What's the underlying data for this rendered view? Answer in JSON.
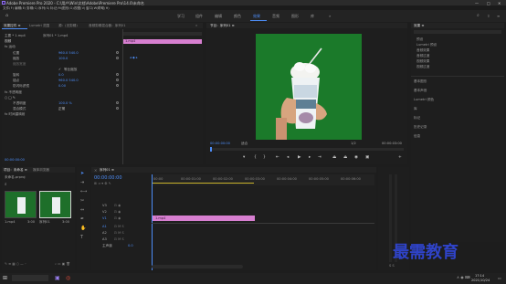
{
  "app": {
    "title": "Adobe Premiere Pro 2020 - C:\\用户\\Win\\文档\\Adobe\\Premiere Pro\\14.0\\未命名",
    "win_controls": [
      "—",
      "□",
      "✕"
    ]
  },
  "menu": [
    "文件(F)",
    "编辑(E)",
    "剪辑(C)",
    "序列(S)",
    "标记(M)",
    "图形(G)",
    "视图(V)",
    "窗口(W)",
    "帮助(H)"
  ],
  "workspaces": [
    "学习",
    "组件",
    "编辑",
    "颜色",
    "效果",
    "音频",
    "图形",
    "库"
  ],
  "active_workspace": "效果",
  "effect_controls": {
    "tabs": [
      "效果控件 ≡",
      "Lumetri 范围",
      "源：(无剪辑)",
      "音频剪辑混合器：序列01"
    ],
    "source_row": "主要 * 1.mp4",
    "seq_row": "序列01 * 1.mp4",
    "clip_name": "1.mp4",
    "section_video": "视频",
    "effects": [
      {
        "name": "fx 运动"
      },
      {
        "name": "位置",
        "value": "960.0  540.0"
      },
      {
        "name": "缩放",
        "value": "100.0"
      },
      {
        "name": "缩放宽度",
        "value": ""
      },
      {
        "name": "等比缩放",
        "value": "✓"
      },
      {
        "name": "旋转",
        "value": "0.0"
      },
      {
        "name": "锚点",
        "value": "960.0  540.0"
      },
      {
        "name": "防闪烁滤镜",
        "value": "0.00"
      },
      {
        "name": "fx 不透明度"
      },
      {
        "name": "不透明度",
        "value": "100.0 %"
      },
      {
        "name": "混合模式",
        "value": "正常"
      },
      {
        "name": "fx 时间重映射"
      }
    ],
    "timecode": "00:00:00:00"
  },
  "program": {
    "tab": "节目：序列01 ≡",
    "timecode_left": "00:00:00:00",
    "fit": "适合",
    "zoom": "1/2",
    "timecode_right": "00:00:03:00"
  },
  "project": {
    "tabs": [
      "项目：未命名 ≡",
      "媒体浏览器"
    ],
    "path": "未命名.prproj",
    "items": [
      {
        "name": "1.mp4",
        "duration": "3:00"
      },
      {
        "name": "序列01",
        "duration": "3:00"
      }
    ]
  },
  "timeline": {
    "tab": "序列01 ≡",
    "timecode": "00:00:00:00",
    "ruler": [
      "00:00",
      "00:00:01:00",
      "00:00:02:00",
      "00:00:03:00",
      "00:00:04:00",
      "00:00:05:00",
      "00:00:06:00"
    ],
    "tracks": [
      "V3",
      "V2",
      "V1",
      "A1",
      "A2",
      "A3",
      "主声道"
    ],
    "master_value": "0.0",
    "clip_label": "1.mp4"
  },
  "effects_panel": {
    "tab": "效果 ≡",
    "tree": [
      "预设",
      "Lumetri 预设",
      "音频效果",
      "音频过渡",
      "视频效果",
      "视频过渡"
    ],
    "sections": [
      "基本图形",
      "基本声音",
      "Lumetri 颜色",
      "库",
      "标记",
      "历史记录",
      "信息"
    ]
  },
  "watermark": "最需教育",
  "clock": {
    "time": "17:14",
    "date": "2021/10/24"
  },
  "colors": {
    "accent": "#4d8df7",
    "clip": "#d77fd0",
    "green_screen": "#1b7a2a"
  }
}
